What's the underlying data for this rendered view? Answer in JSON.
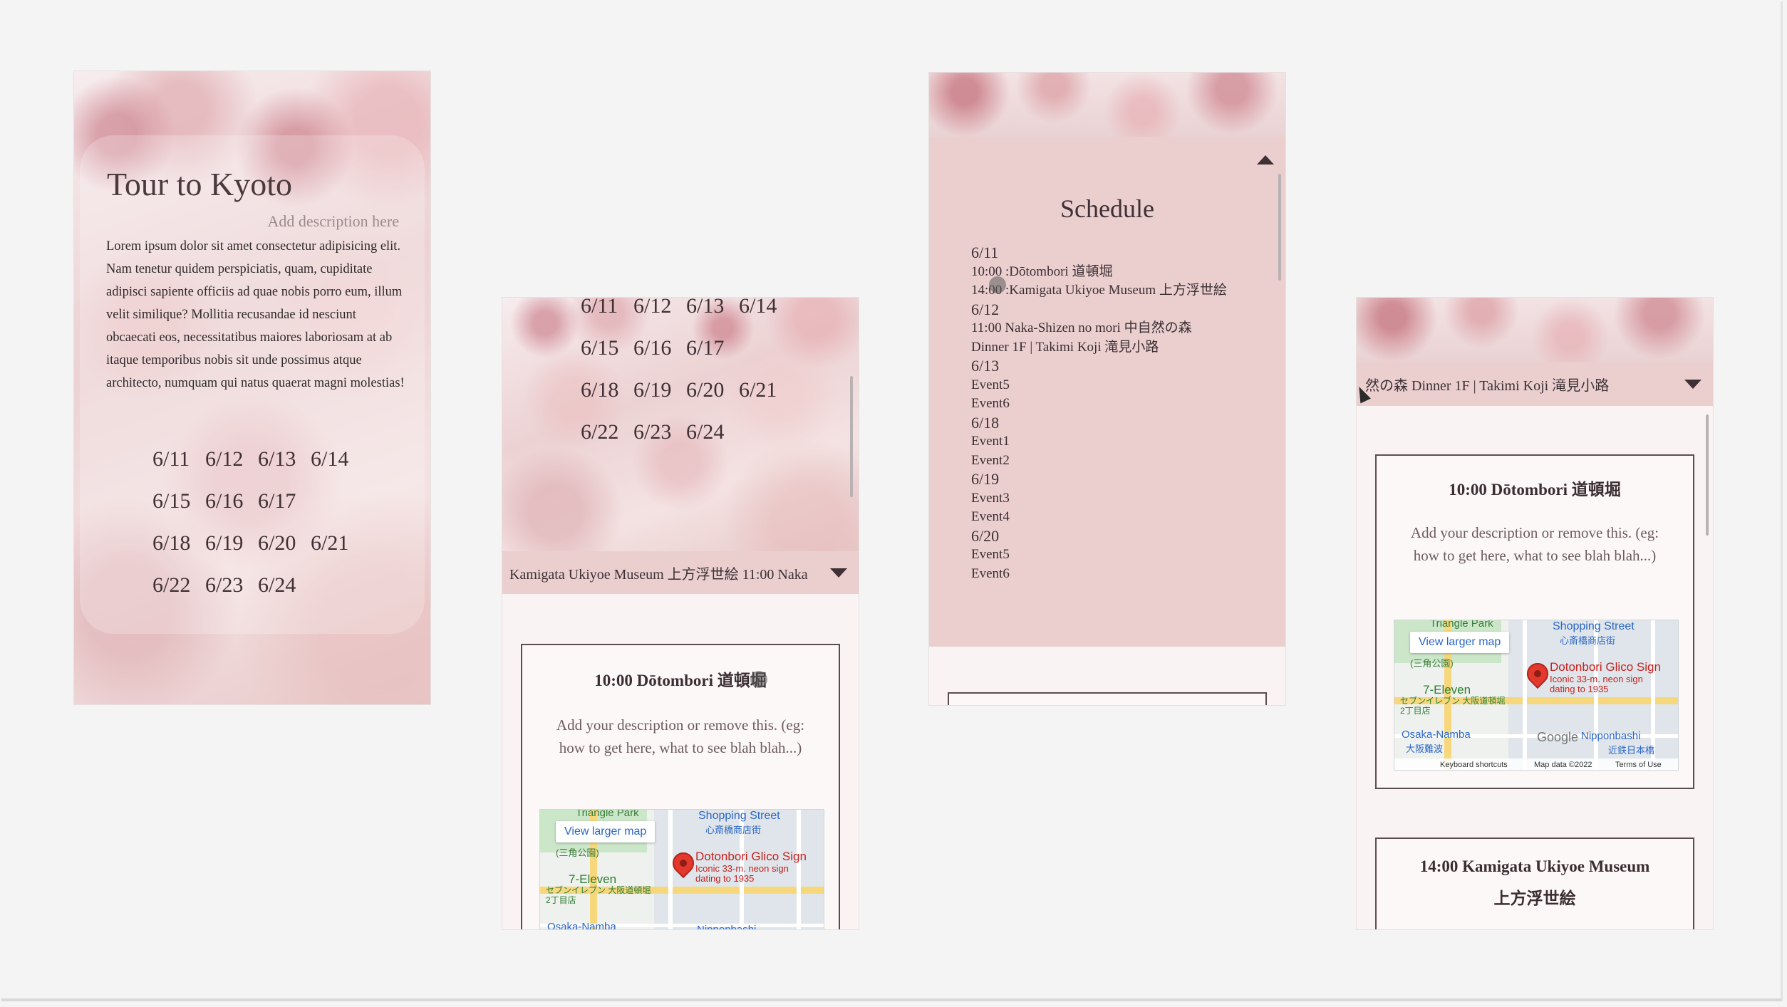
{
  "intro": {
    "title": "Tour to Kyoto",
    "description_placeholder": "Add description here",
    "body": "Lorem ipsum dolor sit amet consectetur adipisicing elit. Nam tenetur quidem perspiciatis, quam, cupiditate adipisci sapiente officiis ad quae nobis porro eum, illum velit similique? Mollitia recusandae id nesciunt obcaecati eos, necessitatibus maiores laboriosam at ab itaque temporibus nobis sit unde possimus atque architecto, numquam qui natus quaerat magni molestias!"
  },
  "dates": [
    "6/11",
    "6/12",
    "6/13",
    "6/14",
    "6/15",
    "6/16",
    "6/17",
    "6/18",
    "6/19",
    "6/20",
    "6/21",
    "6/22",
    "6/23",
    "6/24"
  ],
  "ticker": {
    "screen2_text": "Kamigata Ukiyoe Museum 上方浮世絵    11:00 Naka",
    "screen4_text": "然の森    Dinner 1F | Takimi Koji 滝見小路"
  },
  "event_card": {
    "title": "10:00 Dōtombori 道頓堀",
    "description": "Add your description or remove this. (eg: how to get here, what to see blah blah...)"
  },
  "map": {
    "view_larger": "View larger map",
    "place_name": "Dotonbori Glico Sign",
    "place_desc": "Iconic 33-m. neon sign dating to 1935",
    "shopping": "Shopping Street",
    "shopping_jp": "心斎橋商店街",
    "park": "Triangle Park",
    "park_jp": "(三角公園)",
    "seven_eleven": "7-Eleven",
    "seven_eleven_jp": "セブンイレブン 大阪道頓堀2丁目店",
    "osaka_namba": "Osaka-Namba",
    "osaka_namba_jp": "大阪難波",
    "nipponbashi": "Nipponbashi",
    "nipponbashi_jp": "近鉄日本橋",
    "google": "Google",
    "keyboard": "Keyboard shortcuts",
    "map_data": "Map data ©2022",
    "terms": "Terms of Use"
  },
  "next_card": {
    "title_line1": "14:00 Kamigata Ukiyoe Museum",
    "title_line2": "上方浮世絵"
  },
  "schedule": {
    "title": "Schedule",
    "items": [
      {
        "text": "6/11",
        "date": true
      },
      {
        "text": "10:00 :Dōtombori 道頓堀",
        "date": false
      },
      {
        "text": "14:00 :Kamigata Ukiyoe Museum 上方浮世絵",
        "date": false
      },
      {
        "text": "6/12",
        "date": true
      },
      {
        "text": "11:00 Naka-Shizen no mori 中自然の森",
        "date": false
      },
      {
        "text": "Dinner 1F | Takimi Koji 滝見小路",
        "date": false
      },
      {
        "text": "6/13",
        "date": true
      },
      {
        "text": "Event5",
        "date": false
      },
      {
        "text": "Event6",
        "date": false
      },
      {
        "text": "6/18",
        "date": true
      },
      {
        "text": "Event1",
        "date": false
      },
      {
        "text": "Event2",
        "date": false
      },
      {
        "text": "6/19",
        "date": true
      },
      {
        "text": "Event3",
        "date": false
      },
      {
        "text": "Event4",
        "date": false
      },
      {
        "text": "6/20",
        "date": true
      },
      {
        "text": "Event5",
        "date": false
      },
      {
        "text": "Event6",
        "date": false
      }
    ]
  }
}
